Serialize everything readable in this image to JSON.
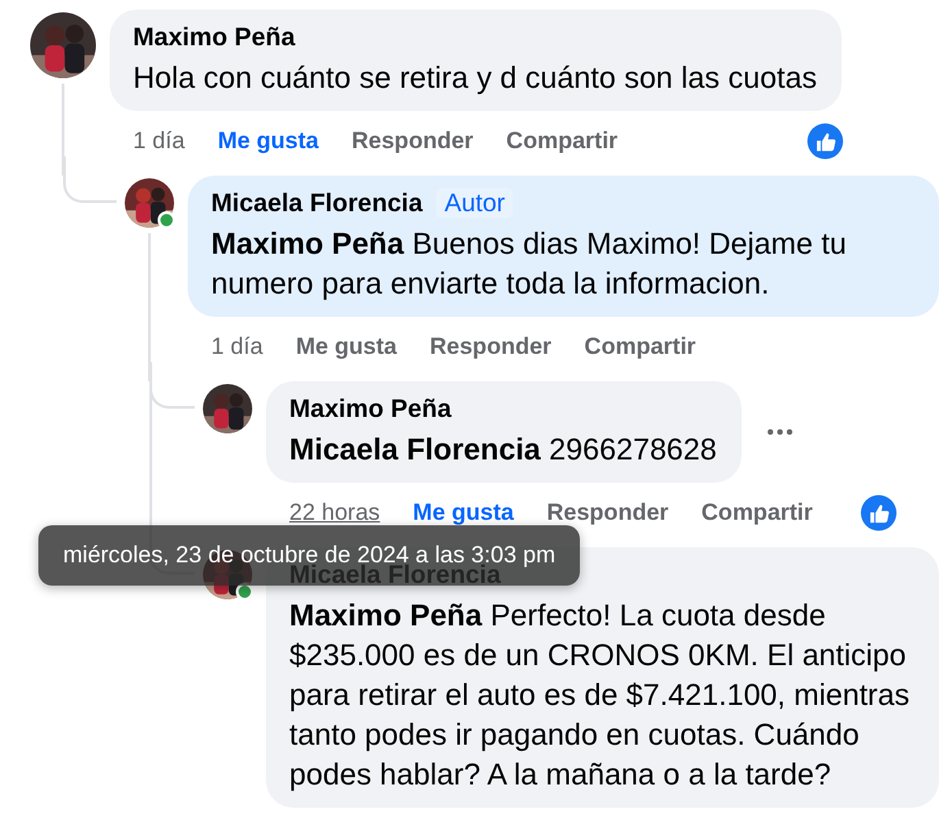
{
  "comments": [
    {
      "author": "Maximo Peña",
      "online": false,
      "highlighted": false,
      "text": "Hola con cuánto se retira y d cuánto son las cuotas",
      "time": "1 día",
      "time_hovered": false,
      "like": "Me gusta",
      "liked": true,
      "reply": "Responder",
      "share": "Compartir",
      "reaction": true,
      "children": [
        {
          "author": "Micaela Florencia",
          "badge": "Autor",
          "online": true,
          "highlighted": true,
          "text": "**Maximo Peña** Buenos dias Maximo! Dejame tu numero para enviarte toda la informacion.",
          "time": "1 día",
          "time_hovered": false,
          "like": "Me gusta",
          "liked": false,
          "reply": "Responder",
          "share": "Compartir",
          "children": [
            {
              "author": "Maximo Peña",
              "online": false,
              "highlighted": false,
              "menu": true,
              "text": "**Micaela Florencia** 2966278628",
              "time": "22 horas",
              "time_hovered": true,
              "like": "Me gusta",
              "liked": true,
              "reply": "Responder",
              "share": "Compartir",
              "reaction": true
            },
            {
              "author": "Micaela Florencia",
              "online": true,
              "highlighted": false,
              "text": "**Maximo Peña** Perfecto! La cuota desde $235.000 es de un CRONOS 0KM. El anticipo para retirar el auto es de $7.421.100, mientras tanto podes ir pagando en cuotas. Cuándo podes hablar? A la mañana o a la tarde?"
            }
          ]
        }
      ]
    }
  ],
  "tooltip": {
    "text": "miércoles, 23 de octubre de 2024 a las 3:03 pm"
  }
}
